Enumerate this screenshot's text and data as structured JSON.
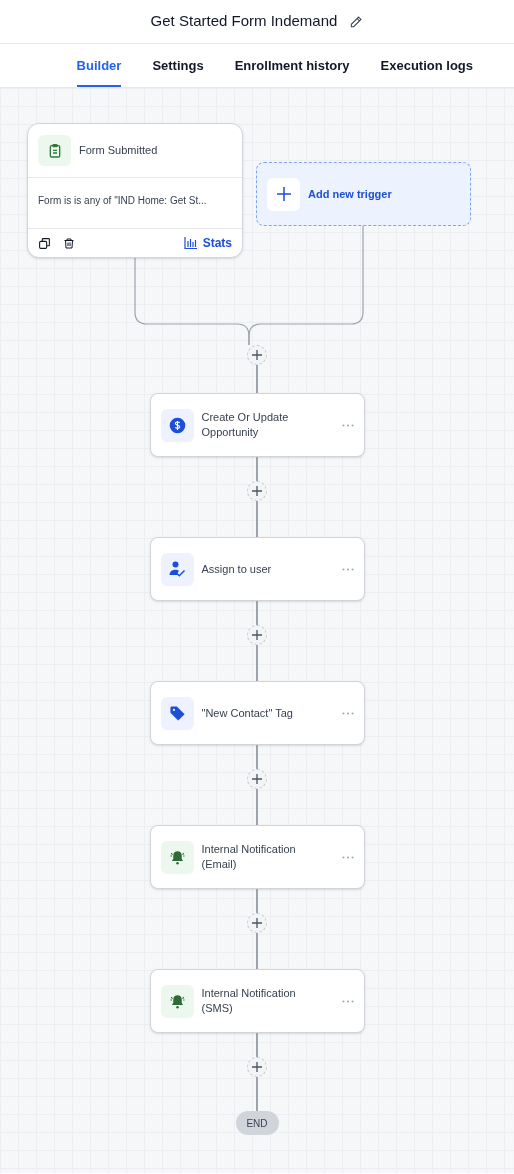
{
  "header": {
    "title": "Get Started Form Indemand"
  },
  "tabs": [
    {
      "label": "Builder",
      "selected": true
    },
    {
      "label": "Settings",
      "selected": false
    },
    {
      "label": "Enrollment history",
      "selected": false
    },
    {
      "label": "Execution logs",
      "selected": false
    }
  ],
  "trigger": {
    "title": "Form Submitted",
    "condition": "Form is is any of \"IND Home: Get St...",
    "stats": "Stats"
  },
  "add_trigger": {
    "label": "Add new trigger"
  },
  "actions": [
    {
      "kind": "opportunity",
      "title": "Create Or Update Opportunity"
    },
    {
      "kind": "assign",
      "title": "Assign to user"
    },
    {
      "kind": "tag",
      "title": "\"New Contact\" Tag"
    },
    {
      "kind": "notification",
      "title": "Internal Notification (Email)"
    },
    {
      "kind": "notification",
      "title": "Internal Notification (SMS)"
    }
  ],
  "end": {
    "label": "END"
  }
}
